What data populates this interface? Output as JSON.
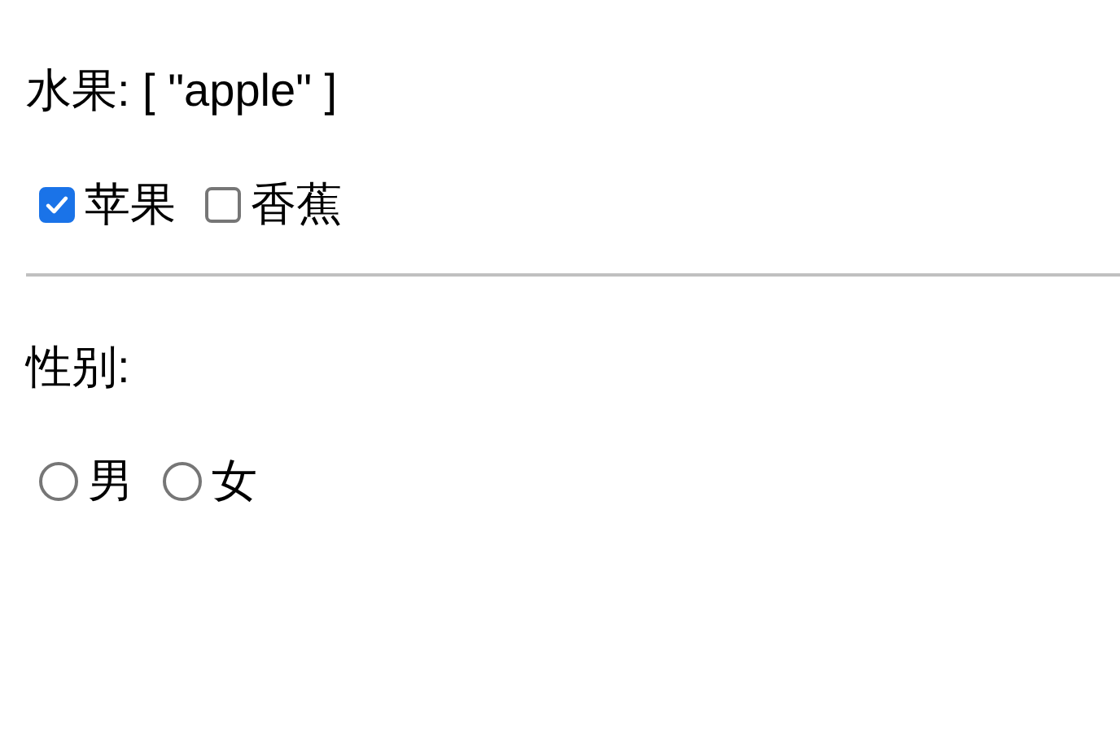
{
  "fruit_summary": "水果: [ \"apple\" ]",
  "fruits": [
    {
      "label": "苹果",
      "checked": true
    },
    {
      "label": "香蕉",
      "checked": false
    }
  ],
  "gender_label": "性别:",
  "genders": [
    {
      "label": "男",
      "selected": false
    },
    {
      "label": "女",
      "selected": false
    }
  ]
}
